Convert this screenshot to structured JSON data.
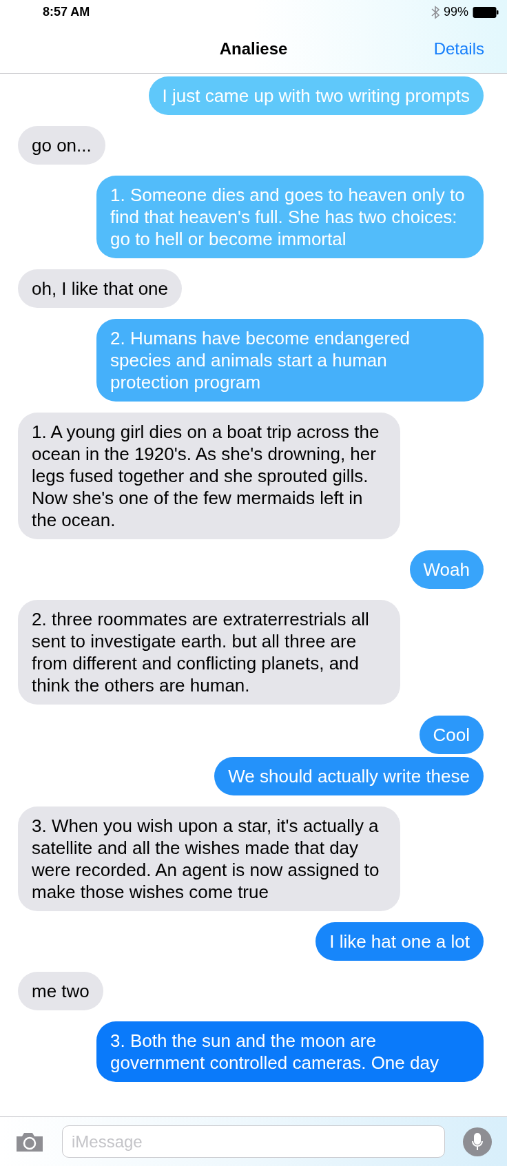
{
  "status_bar": {
    "time": "8:57 AM",
    "battery": "99%"
  },
  "nav": {
    "title": "Analiese",
    "action": "Details"
  },
  "messages": [
    {
      "kind": "sent",
      "text": "I just came up with two writing prompts"
    },
    {
      "kind": "received",
      "text": "go on..."
    },
    {
      "kind": "sent",
      "text": "1. Someone dies and goes to heaven only to find that heaven's full. She has two choices: go to hell or become immortal"
    },
    {
      "kind": "received",
      "text": "oh, I like that one"
    },
    {
      "kind": "sent",
      "text": "2. Humans have become endangered species and animals start a human protection program"
    },
    {
      "kind": "received",
      "text": "1. A young girl dies on a boat trip across the ocean in the 1920's. As she's drowning, her legs fused together and she sprouted gills. Now she's one of the few mermaids left in the ocean."
    },
    {
      "kind": "sent",
      "text": "Woah"
    },
    {
      "kind": "received",
      "text": "2. three roommates are extraterrestrials all sent to investigate earth. but all three are from different and conflicting planets, and think the others are human."
    },
    {
      "kind": "sent",
      "text": "Cool"
    },
    {
      "kind": "sent",
      "text": "We should actually write these"
    },
    {
      "kind": "received",
      "text": "3. When you wish upon a star, it's actually a satellite and all the wishes made that day were recorded. An agent is now assigned to make those wishes come true"
    },
    {
      "kind": "sent",
      "text": "I like hat one a lot"
    },
    {
      "kind": "received",
      "text": "me two"
    },
    {
      "kind": "sent",
      "text": "3. Both the sun and the moon are government controlled cameras. One day"
    }
  ],
  "composer": {
    "placeholder": "iMessage"
  }
}
